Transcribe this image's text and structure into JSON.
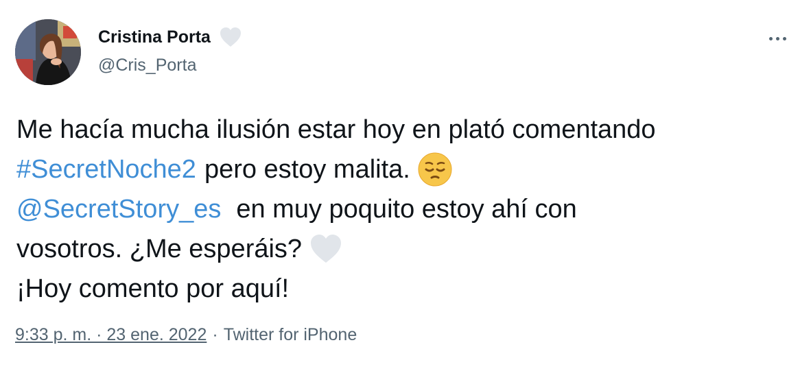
{
  "author": {
    "display_name": "Cristina Porta",
    "handle": "@Cris_Porta",
    "badge_icon": "white-heart-icon"
  },
  "menu": {
    "icon": "more-horizontal-icon"
  },
  "tweet": {
    "line1": "Me hacía mucha ilusión estar hoy en plató comentando",
    "hashtag": "#SecretNoche2",
    "line2_rest": "pero estoy malita.",
    "emoji_pensive": "pensive-face-emoji",
    "mention": "@SecretStory_es",
    "line3_rest": "en muy poquito estoy ahí con",
    "line4": "vosotros. ¿Me esperáis?",
    "emoji_heart": "white-heart-emoji",
    "line5": "¡Hoy comento por aquí!"
  },
  "meta": {
    "timestamp": "9:33 p. m. · 23 ene. 2022",
    "separator": "·",
    "source": "Twitter for iPhone"
  },
  "colors": {
    "link": "#3f8ed6",
    "secondary_text": "#536471",
    "primary_text": "#0f1419"
  }
}
